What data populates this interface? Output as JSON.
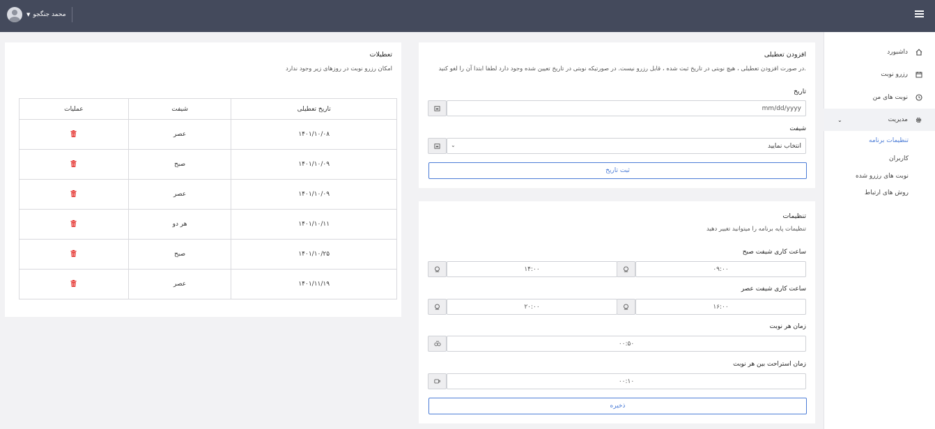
{
  "header": {
    "user_name": "محمد جنگجو",
    "icons": {
      "menu": "hamburger-icon",
      "avatar": "user-avatar-icon",
      "dropdown": "chevron-down-icon"
    }
  },
  "sidebar": {
    "items": [
      {
        "label": "داشبورد",
        "icon": "home-icon"
      },
      {
        "label": "رزرو نوبت",
        "icon": "calendar-icon"
      },
      {
        "label": "نوبت های من",
        "icon": "clock-icon"
      },
      {
        "label": "مدیریت",
        "icon": "gear-icon"
      }
    ],
    "sub_items": [
      {
        "label": "تنظیمات برنامه"
      },
      {
        "label": "کاربران"
      },
      {
        "label": "نوبت های رزرو شده"
      },
      {
        "label": "روش های ارتباط"
      }
    ]
  },
  "add_holiday": {
    "title": "افزودن تعطیلی",
    "description": "در صورت افزودن تعطیلی ، هیچ نوبتی در تاریخ ثبت شده ، قابل رزرو نیست. در صورتیکه نوبتی در تاریخ تعیین شده وجود دارد لطفا ابتدا آن را لغو کنید.",
    "date_label": "تاریخ",
    "date_placeholder": "mm/dd/yyyy",
    "shift_label": "شیفت",
    "shift_selected": "انتخاب نمایید",
    "submit_label": "ثبت تاریخ"
  },
  "settings": {
    "title": "تنظیمات",
    "description": "تنظیمات پایه برنامه را میتوانید تغییر دهید",
    "morning_label": "ساعت کاری شیفت صبح",
    "morning_start": "۰۹:۰۰",
    "morning_end": "۱۴:۰۰",
    "evening_label": "ساعت کاری شیفت عصر",
    "evening_start": "۱۶:۰۰",
    "evening_end": "۲۰:۰۰",
    "slot_label": "زمان هر نوبت",
    "slot_value": "۰۰:۵۰",
    "break_label": "زمان استراحت بین هر نوبت",
    "break_value": "۰۰:۱۰",
    "save_label": "ذخیره"
  },
  "holidays": {
    "title": "تعطیلات",
    "description": "امکان رزرو نوبت در روزهای زیر وجود ندارد",
    "columns": [
      "تاریخ تعطیلی",
      "شیفت",
      "عملیات"
    ],
    "rows": [
      {
        "date": "۱۴۰۱/۱۰/۰۸",
        "shift": "عصر"
      },
      {
        "date": "۱۴۰۱/۱۰/۰۹",
        "shift": "صبح"
      },
      {
        "date": "۱۴۰۱/۱۰/۰۹",
        "shift": "عصر"
      },
      {
        "date": "۱۴۰۱/۱۰/۱۱",
        "shift": "هر دو"
      },
      {
        "date": "۱۴۰۱/۱۰/۲۵",
        "shift": "صبح"
      },
      {
        "date": "۱۴۰۱/۱۱/۱۹",
        "shift": "عصر"
      }
    ]
  },
  "colors": {
    "topbar": "#444a5c",
    "accent": "#4a7bd6",
    "danger": "#e53935"
  }
}
